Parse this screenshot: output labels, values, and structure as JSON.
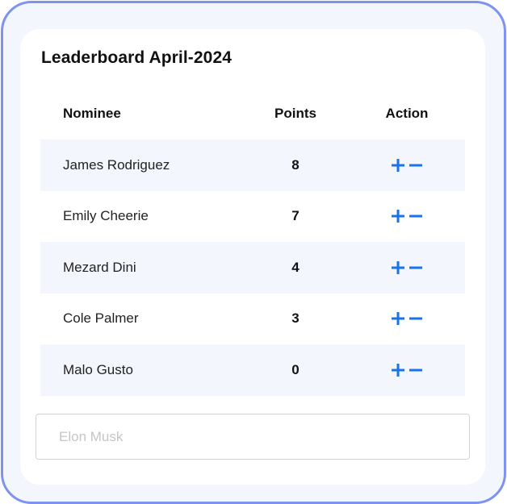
{
  "leaderboard": {
    "title": "Leaderboard April-2024",
    "columns": {
      "nominee": "Nominee",
      "points": "Points",
      "action": "Action"
    },
    "rows": [
      {
        "name": "James Rodriguez",
        "points": "8"
      },
      {
        "name": "Emily Cheerie",
        "points": "7"
      },
      {
        "name": "Mezard Dini",
        "points": "4"
      },
      {
        "name": "Cole Palmer",
        "points": "3"
      },
      {
        "name": "Malo Gusto",
        "points": "0"
      }
    ],
    "actions": {
      "increment_icon": "plus-icon",
      "decrement_icon": "minus-icon"
    }
  },
  "nominee_input": {
    "placeholder": "Elon Musk",
    "value": ""
  },
  "colors": {
    "frame_border": "#7e93f0",
    "frame_background": "#f3f6fd",
    "row_shade": "#f3f6fd",
    "action_blue": "#1a73e8"
  }
}
